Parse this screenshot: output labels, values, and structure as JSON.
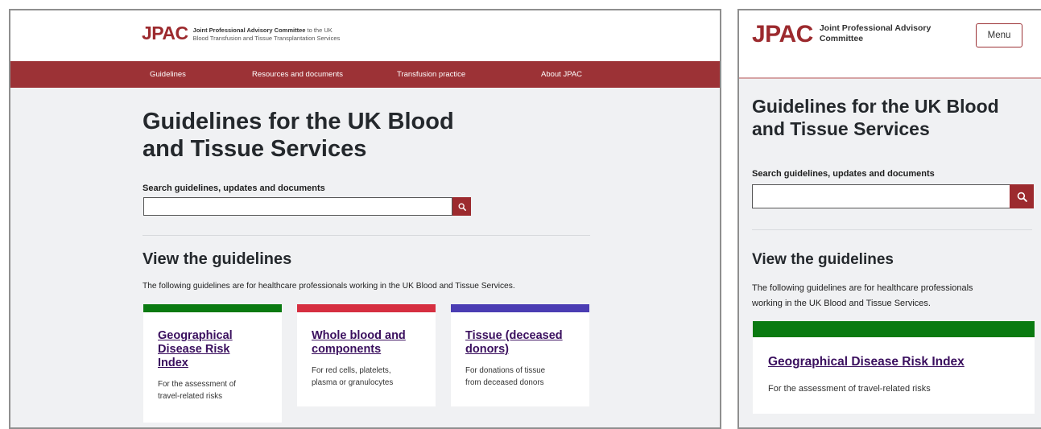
{
  "brand": {
    "logo": "JPAC",
    "tagline_line1_bold": "Joint Professional Advisory Committee",
    "tagline_line1_rest": " to the UK",
    "tagline_line2": "Blood Transfusion and Tissue Transplantation Services",
    "accent_color": "#9c2a2e",
    "nav_color": "#9c3236"
  },
  "nav": {
    "items": [
      "Guidelines",
      "Resources and documents",
      "Transfusion practice",
      "About JPAC"
    ]
  },
  "page": {
    "title_line1": "Guidelines for the UK Blood",
    "title_line2": "and Tissue Services",
    "search_label": "Search guidelines, updates and documents",
    "search_icon": "search-icon",
    "section_title": "View the guidelines",
    "intro": "The following guidelines are for healthcare professionals working in the UK Blood and Tissue Services."
  },
  "cards": [
    {
      "title_lines": [
        "Geographical",
        "Disease Risk",
        "Index"
      ],
      "desc_lines": [
        "For the assessment of",
        "travel-related risks"
      ],
      "color": "#0a7a11"
    },
    {
      "title_lines": [
        "Whole blood and",
        "components"
      ],
      "desc_lines": [
        "For red cells, platelets,",
        "plasma or granulocytes"
      ],
      "color": "#d62f40"
    },
    {
      "title_lines": [
        "Tissue (deceased",
        "donors)"
      ],
      "desc_lines": [
        "For donations of tissue",
        "from deceased donors"
      ],
      "color": "#4b3db3"
    }
  ],
  "mobile": {
    "tagline_line1": "Joint Professional Advisory",
    "tagline_line2": "Committee",
    "menu_label": "Menu",
    "title_line1": "Guidelines for the UK Blood",
    "title_line2": "and Tissue Services",
    "intro_line1": "The following guidelines are for healthcare professionals",
    "intro_line2": "working in the UK Blood and Tissue Services.",
    "card_title": "Geographical Disease Risk Index",
    "card_desc": "For the assessment of travel-related risks",
    "card_color": "#0a7a11"
  }
}
